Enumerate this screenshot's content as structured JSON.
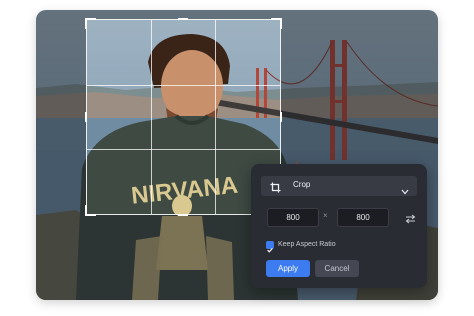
{
  "crop_panel": {
    "mode_label": "Crop",
    "mode_icon": "crop-icon",
    "dropdown_icon": "chevron-down-icon",
    "width_value": "800",
    "height_value": "800",
    "separator": "×",
    "swap_icon": "swap-arrows-icon",
    "keep_aspect_label": "Keep Aspect Ratio",
    "keep_aspect_checked": true,
    "apply_label": "Apply",
    "cancel_label": "Cancel"
  },
  "colors": {
    "panel_bg": "#2a2c33",
    "accent": "#3d7cf0"
  }
}
